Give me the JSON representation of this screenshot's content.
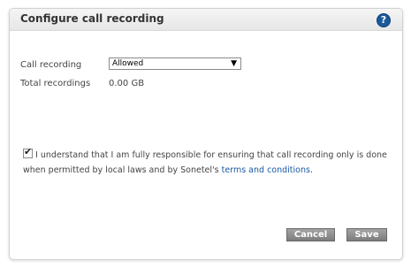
{
  "dialog": {
    "title": "Configure call recording",
    "help_icon": "?"
  },
  "form": {
    "call_recording_label": "Call recording",
    "call_recording_selected": "Allowed",
    "total_recordings_label": "Total recordings",
    "total_recordings_value": "0.00 GB"
  },
  "consent": {
    "checked": true,
    "text": "I understand that I am fully responsible for ensuring that call recording only is done when permitted by local laws and by Sonetel's",
    "link_text": "terms and conditions",
    "suffix": "."
  },
  "buttons": {
    "cancel": "Cancel",
    "save": "Save"
  }
}
